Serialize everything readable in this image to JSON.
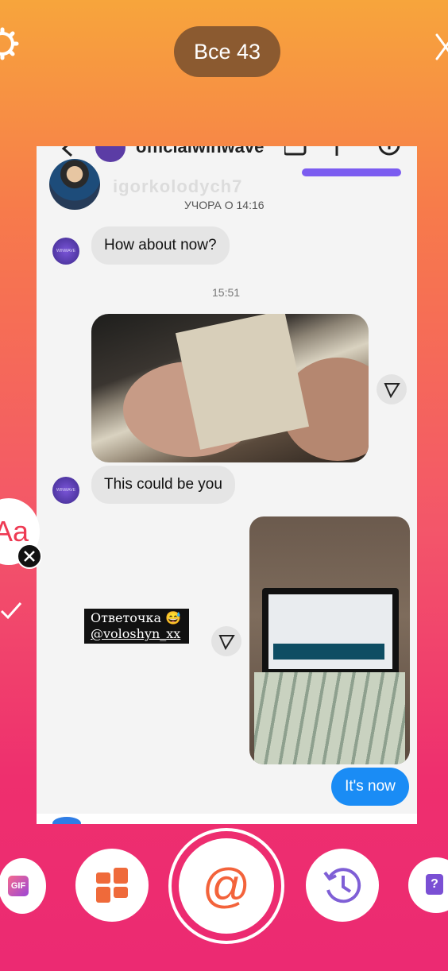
{
  "top_bar": {
    "count_label": "Все 43"
  },
  "chat": {
    "header_name": "officialwinwave",
    "watermark_username": "igorkolodych7",
    "yesterday_label": "УЧОРА О 14:16",
    "avatar_text": "WINWAVE",
    "message1": "How about now?",
    "timestamp": "15:51",
    "message2": "This could be you",
    "reply": "It's now"
  },
  "sticker": {
    "line1": "Ответочка 😅",
    "line2": "@voloshyn_xx"
  },
  "text_tool_label": "Aa",
  "toolbar": {
    "gif_label": "GIF",
    "mention_label": "@",
    "quiz_label": "?"
  },
  "colors": {
    "reply_bubble": "#1a8cf5",
    "mention": "#f3633b",
    "pill": "#8b5a30"
  }
}
